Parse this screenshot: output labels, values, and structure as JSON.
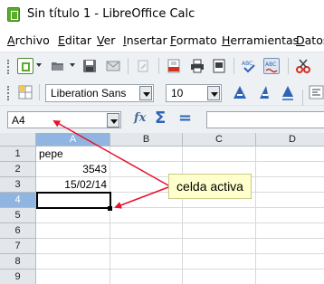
{
  "window": {
    "title": "Sin título 1 - LibreOffice Calc"
  },
  "menu": [
    {
      "label": "Archivo",
      "key": "A",
      "rest": "rchivo"
    },
    {
      "label": "Editar",
      "key": "E",
      "rest": "ditar"
    },
    {
      "label": "Ver",
      "key": "V",
      "rest": "er"
    },
    {
      "label": "Insertar",
      "key": "I",
      "rest": "nsertar"
    },
    {
      "label": "Formato",
      "key": "F",
      "rest": "ormato"
    },
    {
      "label": "Herramientas",
      "key": "H",
      "rest": "erramientas"
    },
    {
      "label": "Datos",
      "key": "D",
      "rest": "atos"
    }
  ],
  "format_bar": {
    "font_name": "Liberation Sans",
    "font_size": "10"
  },
  "formula_bar": {
    "name_box": "A4",
    "formula": ""
  },
  "sheet": {
    "columns": [
      "A",
      "B",
      "C",
      "D"
    ],
    "active_column": "A",
    "rows": [
      "1",
      "2",
      "3",
      "4",
      "5",
      "6",
      "7",
      "8",
      "9"
    ],
    "active_row": "4",
    "cells": [
      {
        "ref": "A1",
        "value": "pepe"
      },
      {
        "ref": "A2",
        "value": "3543"
      },
      {
        "ref": "A3",
        "value": "15/02/14"
      }
    ]
  },
  "annotation": {
    "text": "celda activa",
    "color": "#e8112d"
  },
  "colors": {
    "header_active": "#8fb5e0",
    "callout_bg": "#ffffcc"
  }
}
